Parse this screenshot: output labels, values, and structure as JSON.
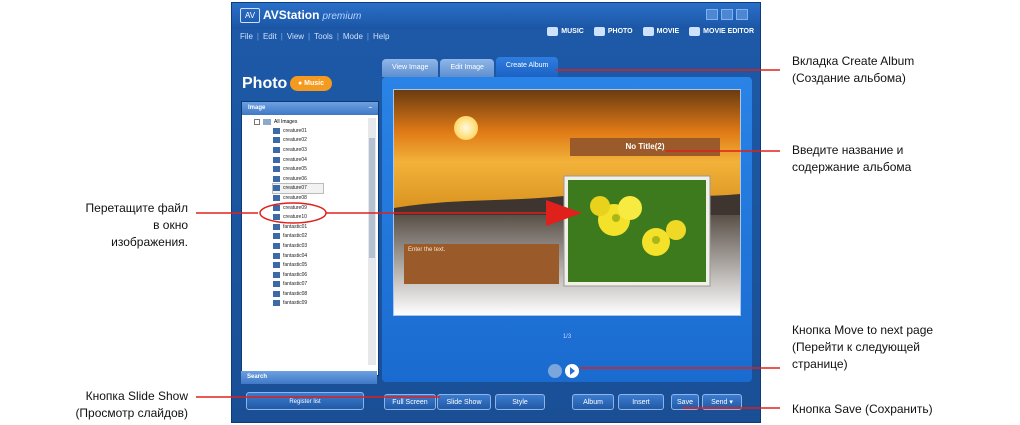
{
  "app": {
    "name": "AVStation",
    "edition": "premium"
  },
  "menubar": [
    "File",
    "Edit",
    "View",
    "Tools",
    "Mode",
    "Help"
  ],
  "modes": [
    {
      "label": "MUSIC",
      "icon": "music-note-icon"
    },
    {
      "label": "PHOTO",
      "icon": "photo-icon"
    },
    {
      "label": "MOVIE",
      "icon": "film-icon"
    },
    {
      "label": "MOVIE EDITOR",
      "icon": "movie-editor-icon"
    }
  ],
  "sidebar": {
    "title": "Photo",
    "music_button": "Music",
    "panel_header": "Image",
    "root": "All Images",
    "items": [
      "creature01",
      "creature02",
      "creature03",
      "creature04",
      "creature05",
      "creature06",
      "creature07",
      "creature08",
      "creature09",
      "creature10",
      "fantastic01",
      "fantastic02",
      "fantastic03",
      "fantastic04",
      "fantastic05",
      "fantastic06",
      "fantastic07",
      "fantastic08",
      "fantastic09"
    ],
    "search_label": "Search",
    "register_button": "Register list"
  },
  "tabs": [
    {
      "label": "View Image"
    },
    {
      "label": "Edit Image"
    },
    {
      "label": "Create Album",
      "active": true
    }
  ],
  "album": {
    "title": "No Title(2)",
    "text_placeholder": "Enter the text.",
    "page": "1/3"
  },
  "toolbar": {
    "full_screen": "Full Screen",
    "slide_show": "Slide Show",
    "style": "Style",
    "album": "Album",
    "insert": "Insert",
    "save": "Save",
    "send": "Send"
  },
  "annotations": {
    "create_album_line1": "Вкладка Create Album",
    "create_album_line2": "(Создание альбома)",
    "title_line1": "Введите название и",
    "title_line2": "содержание альбома",
    "drag_line1": "Перетащите файл",
    "drag_line2": "в окно",
    "drag_line3": "изображения.",
    "next_line1": "Кнопка Move to next page",
    "next_line2": "(Перейти к следующей",
    "next_line3": "странице)",
    "slideshow_line1": "Кнопка Slide Show",
    "slideshow_line2": "(Просмотр слайдов)",
    "save_line1": "Кнопка Save (Сохранить)"
  },
  "colors": {
    "window": "#1d5aa8",
    "accent": "#f39a1f",
    "pointer": "#e0201b"
  }
}
